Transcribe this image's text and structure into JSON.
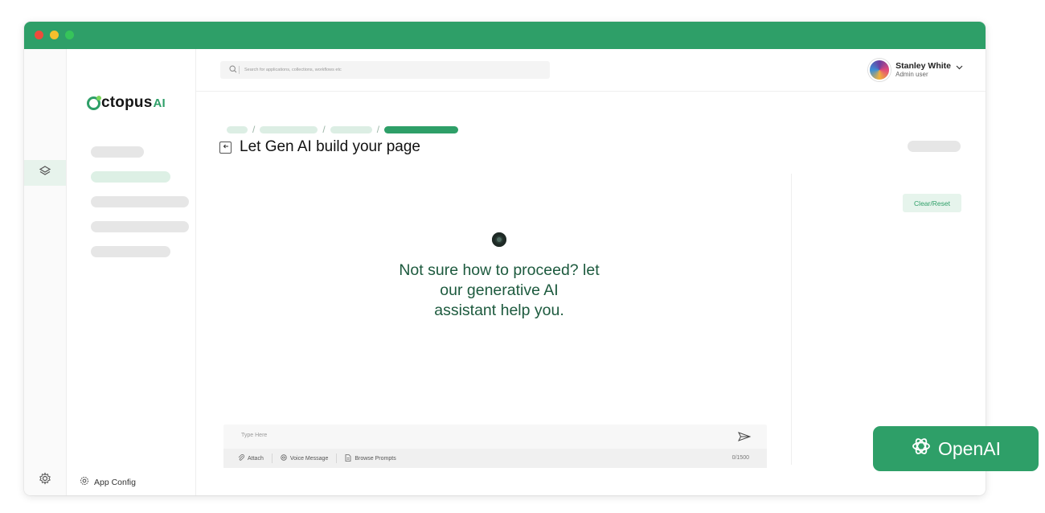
{
  "search": {
    "placeholder": "Search for applications, collections, workflows etc"
  },
  "logo": {
    "main": "ctopus",
    "suffix": "AI"
  },
  "user": {
    "name": "Stanley White",
    "role": "Admin user"
  },
  "page": {
    "title": "Let Gen AI build your page"
  },
  "actions": {
    "clear_reset": "Clear/Reset"
  },
  "empty_state": {
    "message": "Not sure how to proceed? let\nour generative AI\nassistant help you."
  },
  "composer": {
    "placeholder": "Type Here",
    "attach": "Attach",
    "voice": "Voice Message",
    "browse": "Browse Prompts",
    "counter": "0/1500"
  },
  "sidebar": {
    "app_config": "App Config"
  },
  "badge": {
    "label": "OpenAI"
  },
  "colors": {
    "brand": "#2e9f68",
    "brand_light": "#e6f4ec"
  }
}
